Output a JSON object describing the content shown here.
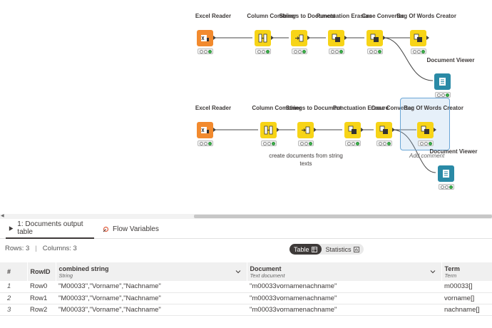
{
  "workflow": {
    "nodes": {
      "excel1": {
        "title": "Excel Reader"
      },
      "colcomb1": {
        "title": "Column Combiner"
      },
      "str2doc1": {
        "title": "Strings to Document"
      },
      "punct1": {
        "title": "Punctuation Erasure"
      },
      "case1": {
        "title": "Case Converter"
      },
      "bow1": {
        "title": "Bag Of Words Creator"
      },
      "docview1": {
        "title": "Document Viewer"
      },
      "excel2": {
        "title": "Excel Reader"
      },
      "colcomb2": {
        "title": "Column Combiner"
      },
      "str2doc2": {
        "title": "Strings to Document",
        "annotation": "create documents from string texts"
      },
      "punct2": {
        "title": "Punctuation Erasure"
      },
      "case2": {
        "title": "Case Converter"
      },
      "bow2": {
        "title": "Bag Of Words Creator",
        "add_comment": "Add comment"
      },
      "docview2": {
        "title": "Document Viewer"
      }
    }
  },
  "panel": {
    "tabs": [
      {
        "label": "1: Documents output table"
      },
      {
        "label": "Flow Variables"
      }
    ],
    "info": {
      "rows": "Rows: 3",
      "sep": "|",
      "columns": "Columns: 3"
    },
    "view_toggle": {
      "table": "Table",
      "statistics": "Statistics"
    },
    "table": {
      "headers": [
        {
          "name": "#",
          "type": ""
        },
        {
          "name": "RowID",
          "type": ""
        },
        {
          "name": "combined string",
          "type": "String"
        },
        {
          "name": "Document",
          "type": "Text document"
        },
        {
          "name": "Term",
          "type": "Term"
        }
      ],
      "rows": [
        {
          "num": "1",
          "id": "Row0",
          "combined": "\"M00033\",\"Vorname\",\"Nachname\"",
          "document": "\"m00033vornamenachname\"",
          "term": "m00033[]"
        },
        {
          "num": "2",
          "id": "Row1",
          "combined": "\"M00033\",\"Vorname\",\"Nachname\"",
          "document": "\"m00033vornamenachname\"",
          "term": "vorname[]"
        },
        {
          "num": "3",
          "id": "Row2",
          "combined": "\"M00033\",\"Vorname\",\"Nachname\"",
          "document": "\"m00033vornamenachname\"",
          "term": "nachname[]"
        }
      ]
    }
  },
  "colors": {
    "excel": "#f28a2e",
    "manipulator": "#f7d417",
    "viewer": "#2a8aa6",
    "active_tab": "#3e3a39"
  }
}
